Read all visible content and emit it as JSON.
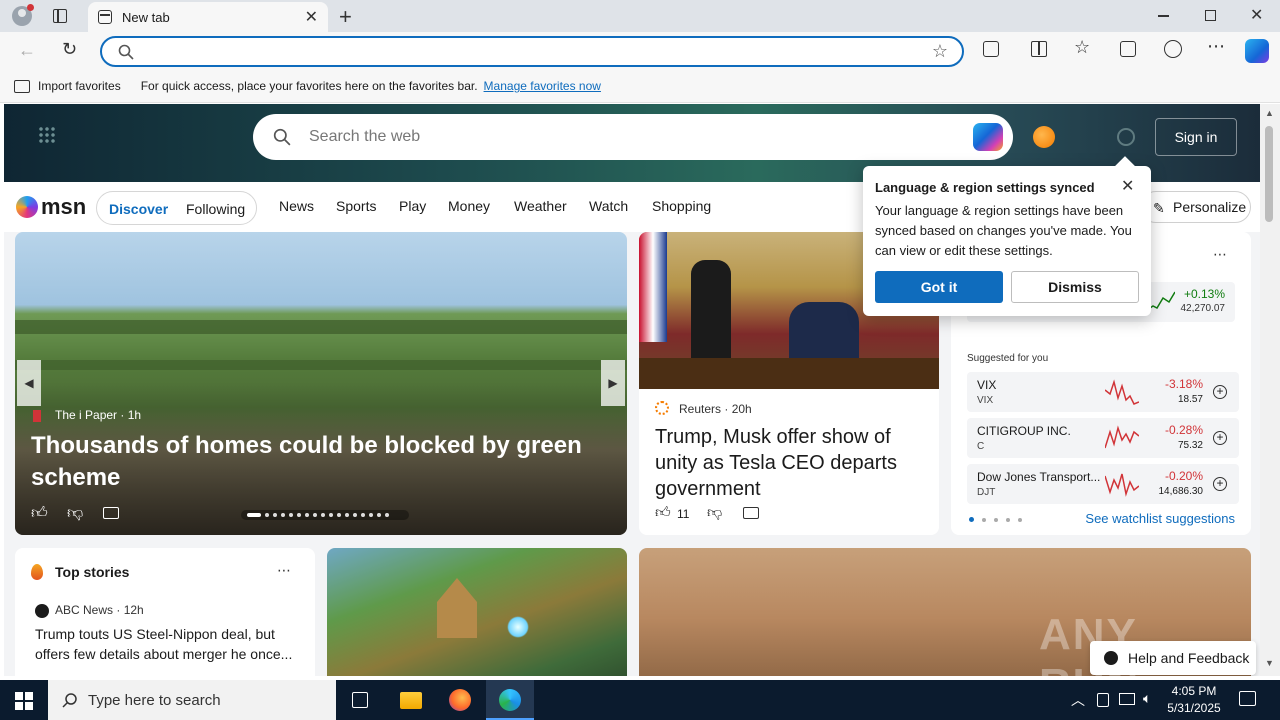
{
  "browser": {
    "tab_title": "New tab",
    "favorites_bar": {
      "import_label": "Import favorites",
      "message": "For quick access, place your favorites here on the favorites bar.",
      "manage_link": "Manage favorites now"
    },
    "address_value": ""
  },
  "msn": {
    "search_placeholder": "Search the web",
    "signin_label": "Sign in",
    "logo_text": "msn",
    "toggle": {
      "discover": "Discover",
      "following": "Following"
    },
    "nav": [
      "News",
      "Sports",
      "Play",
      "Money",
      "Weather",
      "Watch",
      "Shopping"
    ],
    "personalize_label": "Personalize",
    "hero_story": {
      "source": "The i Paper",
      "age": "1h",
      "headline": "Thousands of homes could be blocked by green scheme"
    },
    "side_story": {
      "source": "Reuters",
      "age": "20h",
      "headline": "Trump, Musk offer show of unity as Tesla CEO departs government",
      "likes": "11"
    },
    "top_stories": {
      "title": "Top stories",
      "source": "ABC News",
      "age": "12h",
      "headline": "Trump touts US Steel-Nippon deal, but offers few details about merger he once..."
    },
    "watchlist": {
      "top_change": "+0.13%",
      "top_value": "42,270.07",
      "suggested_label": "Suggested for you",
      "items": [
        {
          "name": "VIX",
          "ticker": "VIX",
          "change": "-3.18%",
          "price": "18.57"
        },
        {
          "name": "CITIGROUP INC.",
          "ticker": "C",
          "change": "-0.28%",
          "price": "75.32"
        },
        {
          "name": "Dow Jones Transport...",
          "ticker": "DJT",
          "change": "-0.20%",
          "price": "14,686.30"
        }
      ],
      "see_more": "See watchlist suggestions"
    },
    "popup": {
      "title": "Language & region settings synced",
      "body": "Your language & region settings have been synced based on changes you've made. You can view or edit these settings.",
      "got_it": "Got it",
      "dismiss": "Dismiss"
    },
    "help_feedback": "Help and Feedback",
    "watermark": "ANY RUN"
  },
  "taskbar": {
    "search_placeholder": "Type here to search",
    "time": "4:05 PM",
    "date": "5/31/2025"
  },
  "colors": {
    "accent": "#0f6cbd",
    "positive": "#107c10",
    "negative": "#d13438"
  }
}
